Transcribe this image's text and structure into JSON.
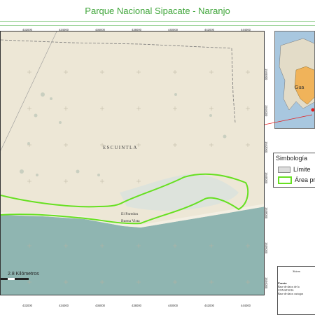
{
  "map": {
    "title": "Parque Nacional Sipacate - Naranjo",
    "place_labels": {
      "region": "ESCUINTLA",
      "town1": "El Paredon",
      "town2": "Buena Vista"
    },
    "x_ticks": [
      "432000",
      "434000",
      "436000",
      "438000",
      "440000",
      "442000",
      "444000"
    ],
    "y_ticks": [
      "1546000",
      "1544000",
      "1542000",
      "1540000",
      "1538000",
      "1536000",
      "1534000"
    ],
    "scale_text": "2.8 Kilómetros",
    "colors": {
      "land": "#ede7d6",
      "ocean": "#8fb5b1",
      "park_outline": "#66e020",
      "limit_line": "#777777"
    }
  },
  "legend": {
    "title": "Simbología",
    "items": [
      {
        "label": "Límite",
        "swatch": "#dddddd"
      },
      {
        "label": "Área pr",
        "swatch": "#66e020"
      }
    ]
  },
  "inset": {
    "label": "Gua"
  },
  "info": {
    "title": "Sistem",
    "source_label": "Fuente:",
    "line1": "Base de datos de la",
    "line2": "CONAP 2016",
    "line3": "Base de datos cartogra"
  }
}
